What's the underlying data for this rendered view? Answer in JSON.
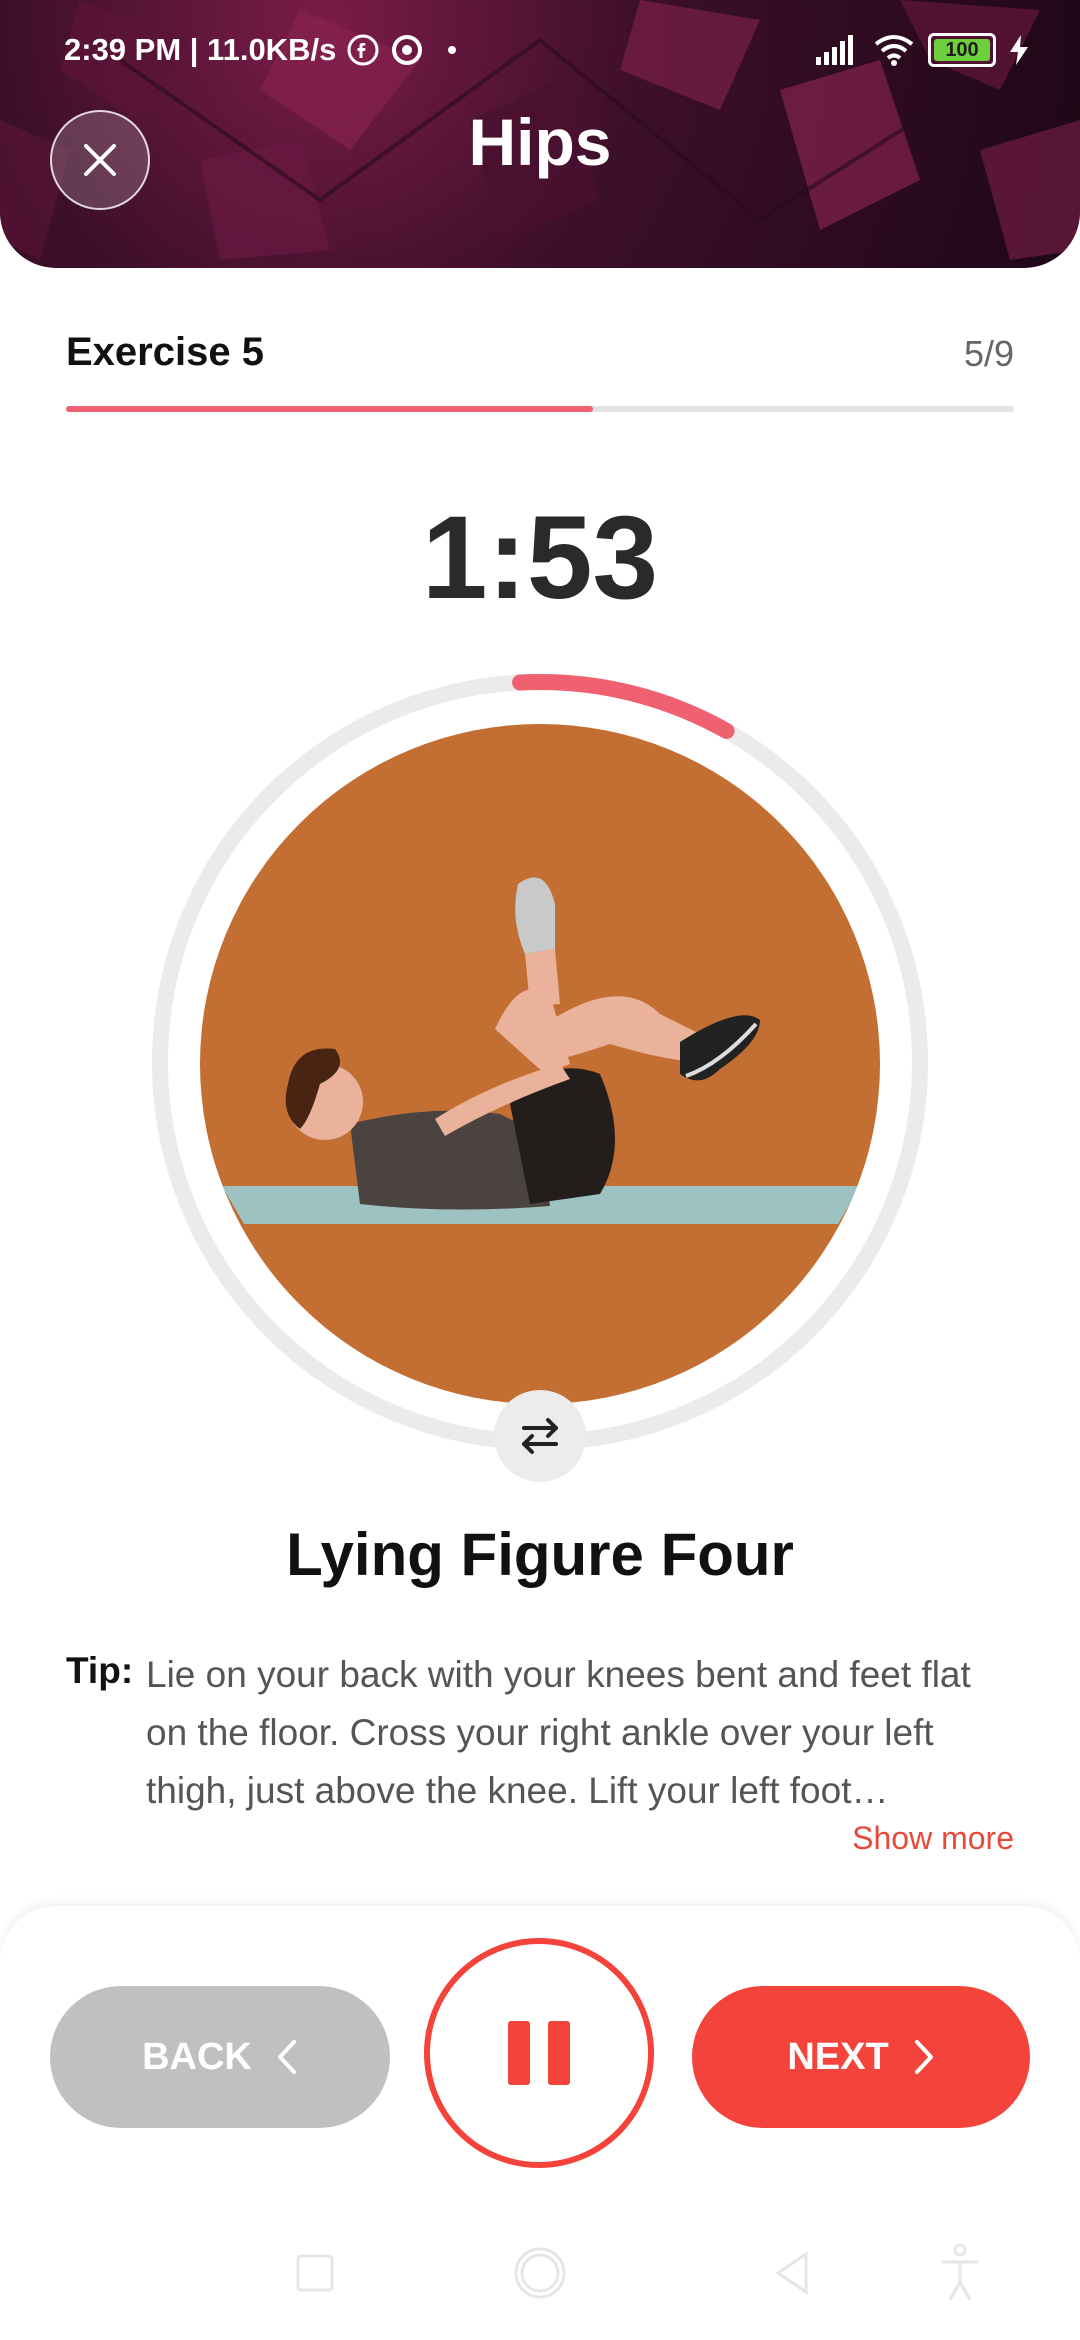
{
  "status_bar": {
    "time_net": "2:39 PM | 11.0KB/s",
    "battery": "100"
  },
  "header": {
    "title": "Hips"
  },
  "progress": {
    "label": "Exercise 5",
    "count": "5/9",
    "fraction": 0.556,
    "color": "#ef6070"
  },
  "timer": {
    "value": "1:53",
    "ring_fraction": 0.09
  },
  "exercise": {
    "name": "Lying Figure Four",
    "tip_label": "Tip:",
    "tip_text": "Lie on your back with your knees bent and feet flat on the floor. Cross your right ankle over your left thigh, just above the knee. Lift your left foot…",
    "show_more": "Show more"
  },
  "controls": {
    "back_label": "BACK",
    "next_label": "NEXT",
    "accent": "#f4433a"
  },
  "icons": {
    "close": "close-icon",
    "switch": "swap-arrows-icon",
    "pause": "pause-icon"
  }
}
